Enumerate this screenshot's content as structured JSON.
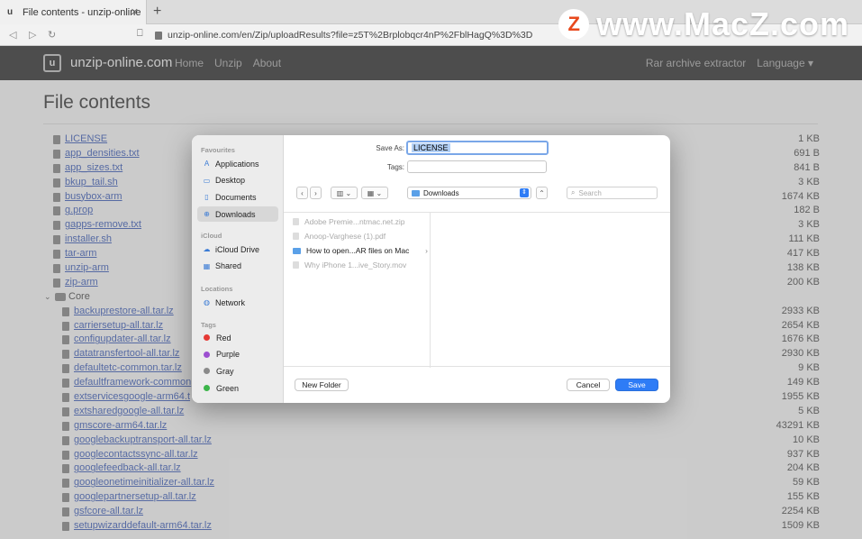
{
  "browser": {
    "tab_title": "File contents - unzip-online",
    "tab_close": "✕",
    "new_tab": "+",
    "favicon": "u",
    "url": "unzip-online.com/en/Zip/uploadResults?file=z5T%2Brplobqcr4nP%2FblHagQ%3D%3D"
  },
  "watermark": {
    "z": "Z",
    "text": "www.MacZ.com"
  },
  "site": {
    "logo": "u",
    "name": "unzip-online.com",
    "nav": [
      "Home",
      "Unzip",
      "About"
    ],
    "right": [
      "Rar archive extractor",
      "Language ▾"
    ]
  },
  "page": {
    "title": "File contents",
    "files": [
      {
        "name": "LICENSE",
        "size": "1 KB"
      },
      {
        "name": "app_densities.txt",
        "size": "691 B"
      },
      {
        "name": "app_sizes.txt",
        "size": "841 B"
      },
      {
        "name": "bkup_tail.sh",
        "size": "3 KB"
      },
      {
        "name": "busybox-arm",
        "size": "1674 KB"
      },
      {
        "name": "g.prop",
        "size": "182 B"
      },
      {
        "name": "gapps-remove.txt",
        "size": "3 KB"
      },
      {
        "name": "installer.sh",
        "size": "111 KB"
      },
      {
        "name": "tar-arm",
        "size": "417 KB"
      },
      {
        "name": "unzip-arm",
        "size": "138 KB"
      },
      {
        "name": "zip-arm",
        "size": "200 KB"
      }
    ],
    "folder": "Core",
    "core_files": [
      {
        "name": "backuprestore-all.tar.lz",
        "size": "2933 KB"
      },
      {
        "name": "carriersetup-all.tar.lz",
        "size": "2654 KB"
      },
      {
        "name": "configupdater-all.tar.lz",
        "size": "1676 KB"
      },
      {
        "name": "datatransfertool-all.tar.lz",
        "size": "2930 KB"
      },
      {
        "name": "defaultetc-common.tar.lz",
        "size": "9 KB"
      },
      {
        "name": "defaultframework-common",
        "size": "149 KB"
      },
      {
        "name": "extservicesgoogle-arm64.t",
        "size": "1955 KB"
      },
      {
        "name": "extsharedgoogle-all.tar.lz",
        "size": "5 KB"
      },
      {
        "name": "gmscore-arm64.tar.lz",
        "size": "43291 KB"
      },
      {
        "name": "googlebackuptransport-all.tar.lz",
        "size": "10 KB"
      },
      {
        "name": "googlecontactssync-all.tar.lz",
        "size": "937 KB"
      },
      {
        "name": "googlefeedback-all.tar.lz",
        "size": "204 KB"
      },
      {
        "name": "googleonetimeinitializer-all.tar.lz",
        "size": "59 KB"
      },
      {
        "name": "googlepartnersetup-all.tar.lz",
        "size": "155 KB"
      },
      {
        "name": "gsfcore-all.tar.lz",
        "size": "2254 KB"
      },
      {
        "name": "setupwizarddefault-arm64.tar.lz",
        "size": "1509 KB"
      }
    ]
  },
  "dialog": {
    "sidebar": {
      "favourites_head": "Favourites",
      "favourites": [
        {
          "label": "Applications",
          "icon": "A"
        },
        {
          "label": "Desktop",
          "icon": "▭"
        },
        {
          "label": "Documents",
          "icon": "▯"
        },
        {
          "label": "Downloads",
          "icon": "⊕"
        }
      ],
      "icloud_head": "iCloud",
      "icloud": [
        {
          "label": "iCloud Drive",
          "icon": "☁"
        },
        {
          "label": "Shared",
          "icon": "▦"
        }
      ],
      "locations_head": "Locations",
      "locations": [
        {
          "label": "Network",
          "icon": "◍"
        }
      ],
      "tags_head": "Tags",
      "tags": [
        {
          "label": "Red",
          "color": "#e53935"
        },
        {
          "label": "Purple",
          "color": "#9c4fd0"
        },
        {
          "label": "Gray",
          "color": "#8a8a8a"
        },
        {
          "label": "Green",
          "color": "#3cb54a"
        }
      ]
    },
    "save_as_label": "Save As:",
    "save_as_value": "LICENSE",
    "tags_label": "Tags:",
    "back": "‹",
    "forward": "›",
    "view_columns": "▥ ⌄",
    "view_grid": "▦ ⌄",
    "location": "Downloads",
    "location_stepper": "⇕",
    "expand": "⌃",
    "search_placeholder": "Search",
    "items": [
      {
        "name": "Adobe Premie...ntmac.net.zip",
        "enabled": false
      },
      {
        "name": "Anoop-Varghese (1).pdf",
        "enabled": false
      },
      {
        "name": "How to open...AR files on Mac",
        "enabled": true,
        "more": "›"
      },
      {
        "name": "Why iPhone 1...ive_Story.mov",
        "enabled": false
      }
    ],
    "new_folder": "New Folder",
    "cancel": "Cancel",
    "save": "Save"
  }
}
